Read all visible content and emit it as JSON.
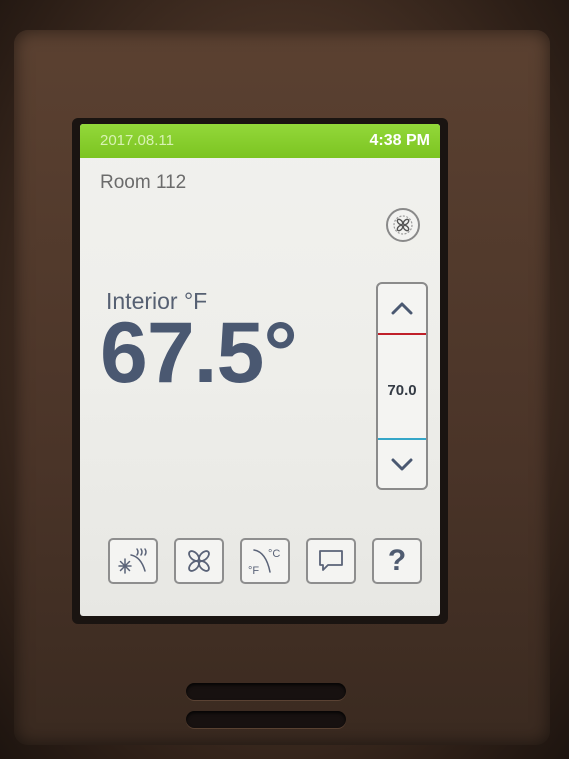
{
  "status_bar": {
    "date": "2017.08.11",
    "time": "4:38 PM"
  },
  "room": "Room 112",
  "fan_status_icon": "fan-icon",
  "interior": {
    "label": "Interior °F",
    "temperature": "67.5°"
  },
  "setpoint": {
    "value": "70.0",
    "up_icon": "chevron-up-icon",
    "down_icon": "chevron-down-icon"
  },
  "bottom_buttons": [
    {
      "name": "mode-button",
      "icon": "snowflake-heat-icon"
    },
    {
      "name": "fan-button",
      "icon": "fan-icon"
    },
    {
      "name": "units-button",
      "icon": "celsius-fahrenheit-icon"
    },
    {
      "name": "message-button",
      "icon": "speech-bubble-icon"
    },
    {
      "name": "help-button",
      "icon": "question-icon",
      "glyph": "?"
    }
  ],
  "colors": {
    "status_green": "#7cc421",
    "heat_line": "#c0202a",
    "cool_line": "#35a6c8",
    "text_blue": "#4a5871"
  }
}
